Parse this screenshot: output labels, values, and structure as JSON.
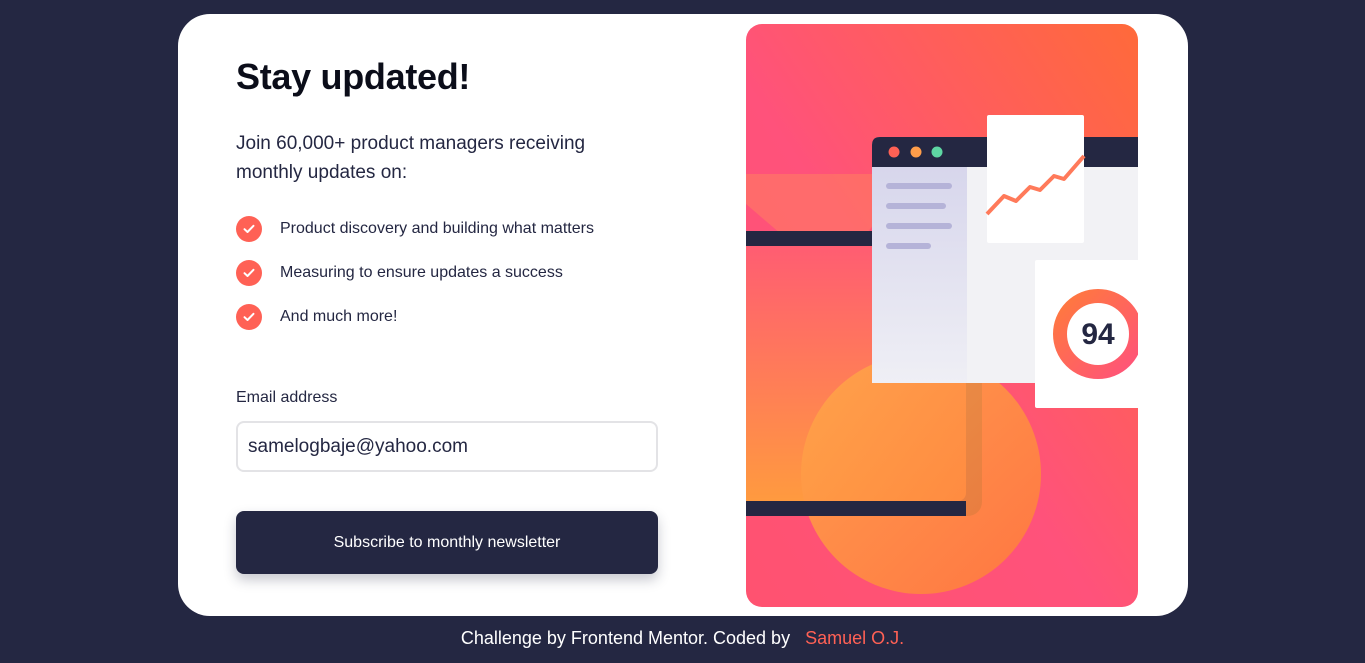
{
  "card": {
    "title": "Stay updated!",
    "intro": "Join 60,000+ product managers receiving monthly updates on:",
    "features": [
      {
        "icon": "check-icon",
        "text": "Product discovery and building what matters"
      },
      {
        "icon": "check-icon",
        "text": "Measuring to ensure updates a success"
      },
      {
        "icon": "check-icon",
        "text": "And much more!"
      }
    ],
    "email_label": "Email address",
    "email_value": "samelogbaje@yahoo.com",
    "subscribe_label": "Subscribe to monthly newsletter",
    "illustration": {
      "score": "94"
    }
  },
  "footer": {
    "text": "Challenge by Frontend Mentor. Coded by",
    "author": "Samuel O.J."
  },
  "colors": {
    "background": "#242742",
    "accent": "#ff6155",
    "card": "#ffffff"
  }
}
